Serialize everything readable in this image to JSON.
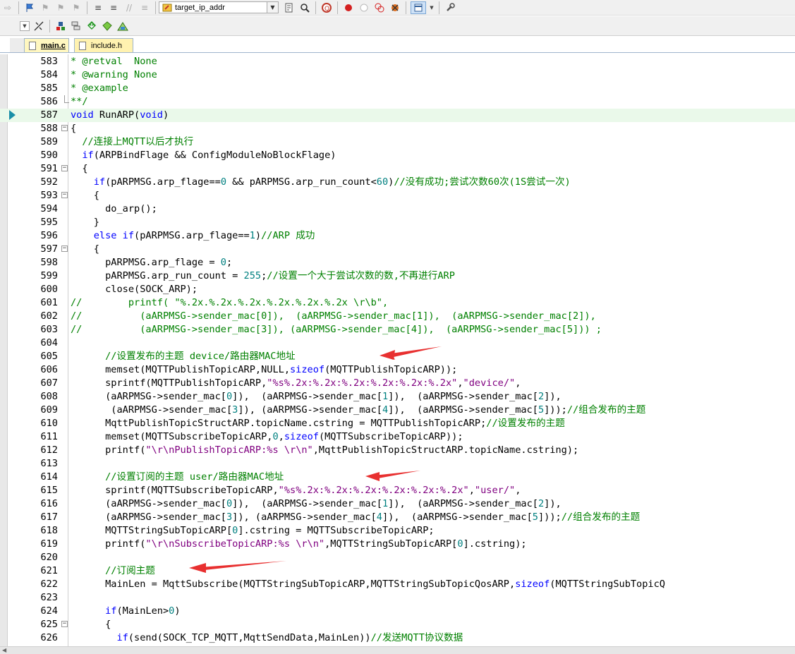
{
  "toolbar": {
    "find_combo_value": "target_ip_addr"
  },
  "tabs": [
    {
      "label": "main.c",
      "active": true
    },
    {
      "label": "include.h",
      "active": false
    }
  ],
  "editor": {
    "current_line": 587,
    "lines": [
      {
        "n": "583",
        "fold": "",
        "segs": [
          [
            "c",
            "* @retval  None"
          ]
        ]
      },
      {
        "n": "584",
        "fold": "",
        "segs": [
          [
            "c",
            "* @warning None"
          ]
        ]
      },
      {
        "n": "585",
        "fold": "",
        "segs": [
          [
            "c",
            "* @example"
          ]
        ]
      },
      {
        "n": "586",
        "fold": "end",
        "segs": [
          [
            "c",
            "**/"
          ]
        ]
      },
      {
        "n": "587",
        "fold": "",
        "cur": true,
        "segs": [
          [
            "k",
            "void"
          ],
          [
            "p",
            " RunARP("
          ],
          [
            "k",
            "void"
          ],
          [
            "p",
            ")"
          ]
        ]
      },
      {
        "n": "588",
        "fold": "open",
        "segs": [
          [
            "p",
            "{"
          ]
        ]
      },
      {
        "n": "589",
        "fold": "",
        "segs": [
          [
            "p",
            "  "
          ],
          [
            "c",
            "//连接上MQTT以后才执行"
          ]
        ]
      },
      {
        "n": "590",
        "fold": "",
        "segs": [
          [
            "p",
            "  "
          ],
          [
            "k",
            "if"
          ],
          [
            "p",
            "(ARPBindFlage && ConfigModuleNoBlockFlage)"
          ]
        ]
      },
      {
        "n": "591",
        "fold": "open",
        "segs": [
          [
            "p",
            "  {"
          ]
        ]
      },
      {
        "n": "592",
        "fold": "",
        "segs": [
          [
            "p",
            "    "
          ],
          [
            "k",
            "if"
          ],
          [
            "p",
            "(pARPMSG.arp_flage=="
          ],
          [
            "n",
            "0"
          ],
          [
            "p",
            " && pARPMSG.arp_run_count<"
          ],
          [
            "n",
            "60"
          ],
          [
            "p",
            ")"
          ],
          [
            "c",
            "//没有成功;尝试次数60次(1S尝试一次)"
          ]
        ]
      },
      {
        "n": "593",
        "fold": "open",
        "segs": [
          [
            "p",
            "    {"
          ]
        ]
      },
      {
        "n": "594",
        "fold": "",
        "segs": [
          [
            "p",
            "      do_arp();"
          ]
        ]
      },
      {
        "n": "595",
        "fold": "",
        "segs": [
          [
            "p",
            "    }"
          ]
        ]
      },
      {
        "n": "596",
        "fold": "",
        "segs": [
          [
            "p",
            "    "
          ],
          [
            "k",
            "else if"
          ],
          [
            "p",
            "(pARPMSG.arp_flage=="
          ],
          [
            "n",
            "1"
          ],
          [
            "p",
            ")"
          ],
          [
            "c",
            "//ARP 成功"
          ]
        ]
      },
      {
        "n": "597",
        "fold": "open",
        "segs": [
          [
            "p",
            "    {"
          ]
        ]
      },
      {
        "n": "598",
        "fold": "",
        "segs": [
          [
            "p",
            "      pARPMSG.arp_flage = "
          ],
          [
            "n",
            "0"
          ],
          [
            "p",
            ";"
          ]
        ]
      },
      {
        "n": "599",
        "fold": "",
        "segs": [
          [
            "p",
            "      pARPMSG.arp_run_count = "
          ],
          [
            "n",
            "255"
          ],
          [
            "p",
            ";"
          ],
          [
            "c",
            "//设置一个大于尝试次数的数,不再进行ARP"
          ]
        ]
      },
      {
        "n": "600",
        "fold": "",
        "segs": [
          [
            "p",
            "      close(SOCK_ARP);"
          ]
        ]
      },
      {
        "n": "601",
        "fold": "",
        "segs": [
          [
            "c",
            "//        printf( \"%.2x.%.2x.%.2x.%.2x.%.2x.%.2x \\r\\b\","
          ]
        ]
      },
      {
        "n": "602",
        "fold": "",
        "segs": [
          [
            "c",
            "//          (aARPMSG->sender_mac[0]),  (aARPMSG->sender_mac[1]),  (aARPMSG->sender_mac[2]),"
          ]
        ]
      },
      {
        "n": "603",
        "fold": "",
        "segs": [
          [
            "c",
            "//          (aARPMSG->sender_mac[3]), (aARPMSG->sender_mac[4]),  (aARPMSG->sender_mac[5])) ;"
          ]
        ]
      },
      {
        "n": "604",
        "fold": "",
        "segs": []
      },
      {
        "n": "605",
        "fold": "",
        "segs": [
          [
            "p",
            "      "
          ],
          [
            "c",
            "//设置发布的主题 device/路由器MAC地址"
          ]
        ]
      },
      {
        "n": "606",
        "fold": "",
        "segs": [
          [
            "p",
            "      memset(MQTTPublishTopicARP,NULL,"
          ],
          [
            "k",
            "sizeof"
          ],
          [
            "p",
            "(MQTTPublishTopicARP));"
          ]
        ]
      },
      {
        "n": "607",
        "fold": "",
        "segs": [
          [
            "p",
            "      sprintf(MQTTPublishTopicARP,"
          ],
          [
            "s",
            "\"%s%.2x:%.2x:%.2x:%.2x:%.2x:%.2x\""
          ],
          [
            "p",
            ","
          ],
          [
            "s",
            "\"device/\""
          ],
          [
            "p",
            ","
          ]
        ]
      },
      {
        "n": "608",
        "fold": "",
        "segs": [
          [
            "p",
            "      (aARPMSG->sender_mac["
          ],
          [
            "n",
            "0"
          ],
          [
            "p",
            "]),  (aARPMSG->sender_mac["
          ],
          [
            "n",
            "1"
          ],
          [
            "p",
            "]),  (aARPMSG->sender_mac["
          ],
          [
            "n",
            "2"
          ],
          [
            "p",
            "]),"
          ]
        ]
      },
      {
        "n": "609",
        "fold": "",
        "segs": [
          [
            "p",
            "       (aARPMSG->sender_mac["
          ],
          [
            "n",
            "3"
          ],
          [
            "p",
            "]), (aARPMSG->sender_mac["
          ],
          [
            "n",
            "4"
          ],
          [
            "p",
            "]),  (aARPMSG->sender_mac["
          ],
          [
            "n",
            "5"
          ],
          [
            "p",
            "]));"
          ],
          [
            "c",
            "//组合发布的主题"
          ]
        ]
      },
      {
        "n": "610",
        "fold": "",
        "segs": [
          [
            "p",
            "      MqttPublishTopicStructARP.topicName.cstring = MQTTPublishTopicARP;"
          ],
          [
            "c",
            "//设置发布的主题"
          ]
        ]
      },
      {
        "n": "611",
        "fold": "",
        "segs": [
          [
            "p",
            "      memset(MQTTSubscribeTopicARP,"
          ],
          [
            "n",
            "0"
          ],
          [
            "p",
            ","
          ],
          [
            "k",
            "sizeof"
          ],
          [
            "p",
            "(MQTTSubscribeTopicARP));"
          ]
        ]
      },
      {
        "n": "612",
        "fold": "",
        "segs": [
          [
            "p",
            "      printf("
          ],
          [
            "s",
            "\"\\r\\nPublishTopicARP:%s \\r\\n\""
          ],
          [
            "p",
            ",MqttPublishTopicStructARP.topicName.cstring);"
          ]
        ]
      },
      {
        "n": "613",
        "fold": "",
        "segs": []
      },
      {
        "n": "614",
        "fold": "",
        "segs": [
          [
            "p",
            "      "
          ],
          [
            "c",
            "//设置订阅的主题 user/路由器MAC地址"
          ]
        ]
      },
      {
        "n": "615",
        "fold": "",
        "segs": [
          [
            "p",
            "      sprintf(MQTTSubscribeTopicARP,"
          ],
          [
            "s",
            "\"%s%.2x:%.2x:%.2x:%.2x:%.2x:%.2x\""
          ],
          [
            "p",
            ","
          ],
          [
            "s",
            "\"user/\""
          ],
          [
            "p",
            ","
          ]
        ]
      },
      {
        "n": "616",
        "fold": "",
        "segs": [
          [
            "p",
            "      (aARPMSG->sender_mac["
          ],
          [
            "n",
            "0"
          ],
          [
            "p",
            "]),  (aARPMSG->sender_mac["
          ],
          [
            "n",
            "1"
          ],
          [
            "p",
            "]),  (aARPMSG->sender_mac["
          ],
          [
            "n",
            "2"
          ],
          [
            "p",
            "]),"
          ]
        ]
      },
      {
        "n": "617",
        "fold": "",
        "segs": [
          [
            "p",
            "      (aARPMSG->sender_mac["
          ],
          [
            "n",
            "3"
          ],
          [
            "p",
            "]), (aARPMSG->sender_mac["
          ],
          [
            "n",
            "4"
          ],
          [
            "p",
            "]),  (aARPMSG->sender_mac["
          ],
          [
            "n",
            "5"
          ],
          [
            "p",
            "]));"
          ],
          [
            "c",
            "//组合发布的主题"
          ]
        ]
      },
      {
        "n": "618",
        "fold": "",
        "segs": [
          [
            "p",
            "      MQTTStringSubTopicARP["
          ],
          [
            "n",
            "0"
          ],
          [
            "p",
            "].cstring = MQTTSubscribeTopicARP;"
          ]
        ]
      },
      {
        "n": "619",
        "fold": "",
        "segs": [
          [
            "p",
            "      printf("
          ],
          [
            "s",
            "\"\\r\\nSubscribeTopicARP:%s \\r\\n\""
          ],
          [
            "p",
            ",MQTTStringSubTopicARP["
          ],
          [
            "n",
            "0"
          ],
          [
            "p",
            "].cstring);"
          ]
        ]
      },
      {
        "n": "620",
        "fold": "",
        "segs": []
      },
      {
        "n": "621",
        "fold": "",
        "segs": [
          [
            "p",
            "      "
          ],
          [
            "c",
            "//订阅主题"
          ]
        ]
      },
      {
        "n": "622",
        "fold": "",
        "segs": [
          [
            "p",
            "      MainLen = MqttSubscribe(MQTTStringSubTopicARP,MQTTStringSubTopicQosARP,"
          ],
          [
            "k",
            "sizeof"
          ],
          [
            "p",
            "(MQTTStringSubTopicQ"
          ]
        ]
      },
      {
        "n": "623",
        "fold": "",
        "segs": []
      },
      {
        "n": "624",
        "fold": "",
        "segs": [
          [
            "p",
            "      "
          ],
          [
            "k",
            "if"
          ],
          [
            "p",
            "(MainLen>"
          ],
          [
            "n",
            "0"
          ],
          [
            "p",
            ")"
          ]
        ]
      },
      {
        "n": "625",
        "fold": "open",
        "segs": [
          [
            "p",
            "      {"
          ]
        ]
      },
      {
        "n": "626",
        "fold": "",
        "segs": [
          [
            "p",
            "        "
          ],
          [
            "k",
            "if"
          ],
          [
            "p",
            "(send(SOCK_TCP_MQTT,MqttSendData,MainLen))"
          ],
          [
            "c",
            "//发送MQTT协议数据"
          ]
        ]
      }
    ]
  },
  "colors": {
    "keyword": "#0000ff",
    "comment": "#008000",
    "string": "#800080",
    "number": "#008080",
    "current_line_bg": "#eaf9ea",
    "annotation_arrow": "#e83030"
  }
}
